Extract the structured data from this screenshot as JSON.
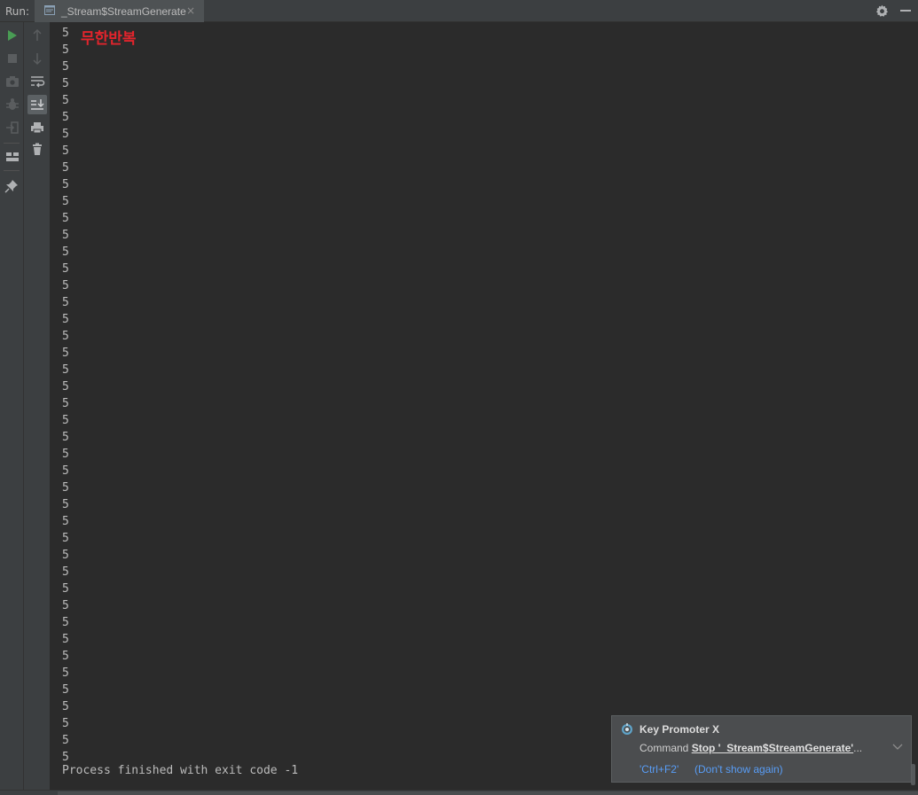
{
  "header": {
    "run_label": "Run:",
    "tab_label": "_Stream$StreamGenerate",
    "tab_close": "×"
  },
  "toolbar_left": {
    "icons": [
      "run-icon",
      "stop-icon",
      "camera-icon",
      "debug-icon",
      "login-icon",
      "layout-icon",
      "pin-icon"
    ]
  },
  "toolbar_mid": {
    "icons": [
      "arrow-up-icon",
      "arrow-down-icon",
      "soft-wrap-icon",
      "scroll-to-end-icon",
      "print-icon",
      "trash-icon"
    ]
  },
  "console": {
    "lines": [
      "5",
      "5",
      "5",
      "5",
      "5",
      "5",
      "5",
      "5",
      "5",
      "5",
      "5",
      "5",
      "5",
      "5",
      "5",
      "5",
      "5",
      "5",
      "5",
      "5",
      "5",
      "5",
      "5",
      "5",
      "5",
      "5",
      "5",
      "5",
      "5",
      "5",
      "5",
      "5",
      "5",
      "5",
      "5",
      "5",
      "5",
      "5",
      "5",
      "5",
      "5",
      "5",
      "5",
      "5"
    ],
    "annotation": "무한반복",
    "annotation_color": "#e2242c",
    "process_message": "Process finished with exit code -1"
  },
  "notification": {
    "title": "Key Promoter X",
    "command_label": "Command ",
    "command_value": "Stop '_Stream$StreamGenerate'",
    "ellipsis": "...",
    "shortcut": "'Ctrl+F2'",
    "dont_show": "(Don't show again)"
  },
  "colors": {
    "background": "#2b2b2b",
    "toolbar": "#3c3f41",
    "run_green": "#499c54",
    "link_blue": "#589df6"
  }
}
